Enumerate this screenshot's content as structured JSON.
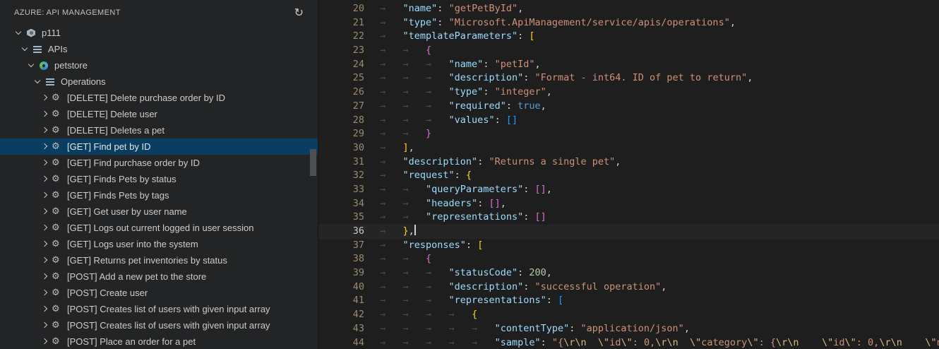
{
  "colors": {
    "editor_bg": "#1e1e1e",
    "sidebar_bg": "#232425",
    "selection_bg": "#0a3d62",
    "key": "#9cdcfe",
    "string": "#ce9178",
    "escape": "#d7ba7d",
    "number": "#b5cea8",
    "keyword": "#569cd6",
    "bracket_gold": "#ffd700",
    "bracket_orchid": "#da70d6",
    "bracket_blue": "#179fff",
    "line_number": "#9c8a6e",
    "line_number_active": "#c8c8c8"
  },
  "sidebar": {
    "title": "AZURE: API MANAGEMENT",
    "refresh_glyph": "↻",
    "tree": [
      {
        "label": "p111",
        "level": 0,
        "expanded": true,
        "icon": "apim",
        "selected": false
      },
      {
        "label": "APIs",
        "level": 1,
        "expanded": true,
        "icon": "list",
        "selected": false
      },
      {
        "label": "petstore",
        "level": 2,
        "expanded": true,
        "icon": "api",
        "selected": false
      },
      {
        "label": "Operations",
        "level": 3,
        "expanded": true,
        "icon": "list",
        "selected": false
      },
      {
        "label": "[DELETE] Delete purchase order by ID",
        "level": 4,
        "expanded": false,
        "icon": "gear",
        "selected": false
      },
      {
        "label": "[DELETE] Delete user",
        "level": 4,
        "expanded": false,
        "icon": "gear",
        "selected": false
      },
      {
        "label": "[DELETE] Deletes a pet",
        "level": 4,
        "expanded": false,
        "icon": "gear",
        "selected": false
      },
      {
        "label": "[GET] Find pet by ID",
        "level": 4,
        "expanded": false,
        "icon": "gear",
        "selected": true
      },
      {
        "label": "[GET] Find purchase order by ID",
        "level": 4,
        "expanded": false,
        "icon": "gear",
        "selected": false
      },
      {
        "label": "[GET] Finds Pets by status",
        "level": 4,
        "expanded": false,
        "icon": "gear",
        "selected": false
      },
      {
        "label": "[GET] Finds Pets by tags",
        "level": 4,
        "expanded": false,
        "icon": "gear",
        "selected": false
      },
      {
        "label": "[GET] Get user by user name",
        "level": 4,
        "expanded": false,
        "icon": "gear",
        "selected": false
      },
      {
        "label": "[GET] Logs out current logged in user session",
        "level": 4,
        "expanded": false,
        "icon": "gear",
        "selected": false
      },
      {
        "label": "[GET] Logs user into the system",
        "level": 4,
        "expanded": false,
        "icon": "gear",
        "selected": false
      },
      {
        "label": "[GET] Returns pet inventories by status",
        "level": 4,
        "expanded": false,
        "icon": "gear",
        "selected": false
      },
      {
        "label": "[POST] Add a new pet to the store",
        "level": 4,
        "expanded": false,
        "icon": "gear",
        "selected": false
      },
      {
        "label": "[POST] Create user",
        "level": 4,
        "expanded": false,
        "icon": "gear",
        "selected": false
      },
      {
        "label": "[POST] Creates list of users with given input array",
        "level": 4,
        "expanded": false,
        "icon": "gear",
        "selected": false
      },
      {
        "label": "[POST] Creates list of users with given input array",
        "level": 4,
        "expanded": false,
        "icon": "gear",
        "selected": false
      },
      {
        "label": "[POST] Place an order for a pet",
        "level": 4,
        "expanded": false,
        "icon": "gear",
        "selected": false
      }
    ]
  },
  "editor": {
    "language": "json",
    "whitespace_glyph": "→   ",
    "lines": [
      {
        "n": "20",
        "indent": 1,
        "current": false,
        "cursor": false,
        "tokens": [
          [
            "k",
            "\"name\""
          ],
          [
            "p",
            ": "
          ],
          [
            "s",
            "\"getPetById\""
          ],
          [
            "p",
            ","
          ]
        ]
      },
      {
        "n": "21",
        "indent": 1,
        "current": false,
        "cursor": false,
        "tokens": [
          [
            "k",
            "\"type\""
          ],
          [
            "p",
            ": "
          ],
          [
            "s",
            "\"Microsoft.ApiManagement/service/apis/operations\""
          ],
          [
            "p",
            ","
          ]
        ]
      },
      {
        "n": "22",
        "indent": 1,
        "current": false,
        "cursor": false,
        "tokens": [
          [
            "k",
            "\"templateParameters\""
          ],
          [
            "p",
            ": "
          ],
          [
            "b1",
            "["
          ]
        ]
      },
      {
        "n": "23",
        "indent": 2,
        "current": false,
        "cursor": false,
        "tokens": [
          [
            "b2",
            "{"
          ]
        ]
      },
      {
        "n": "24",
        "indent": 3,
        "current": false,
        "cursor": false,
        "tokens": [
          [
            "k",
            "\"name\""
          ],
          [
            "p",
            ": "
          ],
          [
            "s",
            "\"petId\""
          ],
          [
            "p",
            ","
          ]
        ]
      },
      {
        "n": "25",
        "indent": 3,
        "current": false,
        "cursor": false,
        "tokens": [
          [
            "k",
            "\"description\""
          ],
          [
            "p",
            ": "
          ],
          [
            "s",
            "\"Format - int64. ID of pet to return\""
          ],
          [
            "p",
            ","
          ]
        ]
      },
      {
        "n": "26",
        "indent": 3,
        "current": false,
        "cursor": false,
        "tokens": [
          [
            "k",
            "\"type\""
          ],
          [
            "p",
            ": "
          ],
          [
            "s",
            "\"integer\""
          ],
          [
            "p",
            ","
          ]
        ]
      },
      {
        "n": "27",
        "indent": 3,
        "current": false,
        "cursor": false,
        "tokens": [
          [
            "k",
            "\"required\""
          ],
          [
            "p",
            ": "
          ],
          [
            "kw",
            "true"
          ],
          [
            "p",
            ","
          ]
        ]
      },
      {
        "n": "28",
        "indent": 3,
        "current": false,
        "cursor": false,
        "tokens": [
          [
            "k",
            "\"values\""
          ],
          [
            "p",
            ": "
          ],
          [
            "b3",
            "[]"
          ]
        ]
      },
      {
        "n": "29",
        "indent": 2,
        "current": false,
        "cursor": false,
        "tokens": [
          [
            "b2",
            "}"
          ]
        ]
      },
      {
        "n": "30",
        "indent": 1,
        "current": false,
        "cursor": false,
        "tokens": [
          [
            "b1",
            "]"
          ],
          [
            "p",
            ","
          ]
        ]
      },
      {
        "n": "31",
        "indent": 1,
        "current": false,
        "cursor": false,
        "tokens": [
          [
            "k",
            "\"description\""
          ],
          [
            "p",
            ": "
          ],
          [
            "s",
            "\"Returns a single pet\""
          ],
          [
            "p",
            ","
          ]
        ]
      },
      {
        "n": "32",
        "indent": 1,
        "current": false,
        "cursor": false,
        "tokens": [
          [
            "k",
            "\"request\""
          ],
          [
            "p",
            ": "
          ],
          [
            "b1",
            "{"
          ]
        ]
      },
      {
        "n": "33",
        "indent": 2,
        "current": false,
        "cursor": false,
        "tokens": [
          [
            "k",
            "\"queryParameters\""
          ],
          [
            "p",
            ": "
          ],
          [
            "b2",
            "[]"
          ],
          [
            "p",
            ","
          ]
        ]
      },
      {
        "n": "34",
        "indent": 2,
        "current": false,
        "cursor": false,
        "tokens": [
          [
            "k",
            "\"headers\""
          ],
          [
            "p",
            ": "
          ],
          [
            "b2",
            "[]"
          ],
          [
            "p",
            ","
          ]
        ]
      },
      {
        "n": "35",
        "indent": 2,
        "current": false,
        "cursor": false,
        "tokens": [
          [
            "k",
            "\"representations\""
          ],
          [
            "p",
            ": "
          ],
          [
            "b2",
            "[]"
          ]
        ]
      },
      {
        "n": "36",
        "indent": 1,
        "current": true,
        "cursor": true,
        "tokens": [
          [
            "b1",
            "}"
          ],
          [
            "p",
            ","
          ]
        ]
      },
      {
        "n": "37",
        "indent": 1,
        "current": false,
        "cursor": false,
        "tokens": [
          [
            "k",
            "\"responses\""
          ],
          [
            "p",
            ": "
          ],
          [
            "b1",
            "["
          ]
        ]
      },
      {
        "n": "38",
        "indent": 2,
        "current": false,
        "cursor": false,
        "tokens": [
          [
            "b2",
            "{"
          ]
        ]
      },
      {
        "n": "39",
        "indent": 3,
        "current": false,
        "cursor": false,
        "tokens": [
          [
            "k",
            "\"statusCode\""
          ],
          [
            "p",
            ": "
          ],
          [
            "n",
            "200"
          ],
          [
            "p",
            ","
          ]
        ]
      },
      {
        "n": "40",
        "indent": 3,
        "current": false,
        "cursor": false,
        "tokens": [
          [
            "k",
            "\"description\""
          ],
          [
            "p",
            ": "
          ],
          [
            "s",
            "\"successful operation\""
          ],
          [
            "p",
            ","
          ]
        ]
      },
      {
        "n": "41",
        "indent": 3,
        "current": false,
        "cursor": false,
        "tokens": [
          [
            "k",
            "\"representations\""
          ],
          [
            "p",
            ": "
          ],
          [
            "b3",
            "["
          ]
        ]
      },
      {
        "n": "42",
        "indent": 4,
        "current": false,
        "cursor": false,
        "tokens": [
          [
            "b1",
            "{"
          ]
        ]
      },
      {
        "n": "43",
        "indent": 5,
        "current": false,
        "cursor": false,
        "tokens": [
          [
            "k",
            "\"contentType\""
          ],
          [
            "p",
            ": "
          ],
          [
            "s",
            "\"application/json\""
          ],
          [
            "p",
            ","
          ]
        ]
      },
      {
        "n": "44",
        "indent": 5,
        "current": false,
        "cursor": false,
        "tokens": [
          [
            "k",
            "\"sample\""
          ],
          [
            "p",
            ": "
          ],
          [
            "s",
            "\"{"
          ],
          [
            "e",
            "\\r\\n"
          ],
          [
            "s",
            "  "
          ],
          [
            "e",
            "\\\""
          ],
          [
            "s",
            "id"
          ],
          [
            "e",
            "\\\""
          ],
          [
            "s",
            ": 0,"
          ],
          [
            "e",
            "\\r\\n"
          ],
          [
            "s",
            "  "
          ],
          [
            "e",
            "\\\""
          ],
          [
            "s",
            "category"
          ],
          [
            "e",
            "\\\""
          ],
          [
            "s",
            ": {"
          ],
          [
            "e",
            "\\r\\n"
          ],
          [
            "s",
            "    "
          ],
          [
            "e",
            "\\\""
          ],
          [
            "s",
            "id"
          ],
          [
            "e",
            "\\\""
          ],
          [
            "s",
            ": 0,"
          ],
          [
            "e",
            "\\r\\n"
          ],
          [
            "s",
            "    "
          ],
          [
            "e",
            "\\\""
          ],
          [
            "s",
            "name"
          ]
        ]
      }
    ]
  }
}
